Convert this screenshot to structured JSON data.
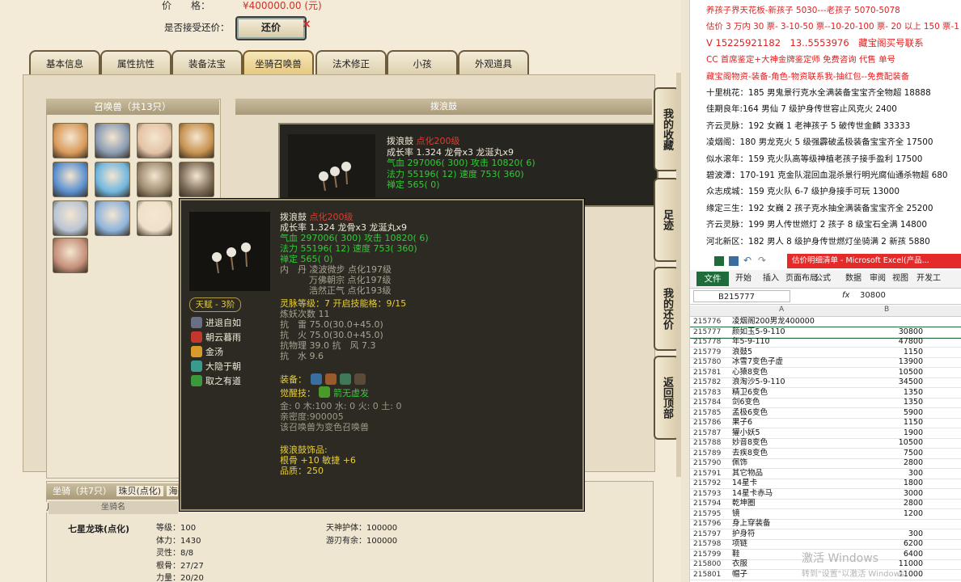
{
  "trade": {
    "price_label": "价　　格：",
    "price_value": "¥400000.00 (元)",
    "accept_label": "是否接受还价：",
    "counter_button": "还价",
    "close_symbol": "×"
  },
  "tabs": [
    "基本信息",
    "属性抗性",
    "装备法宝",
    "坐骑召唤兽",
    "法术修正",
    "小孩",
    "外观道具"
  ],
  "summon_list": {
    "title": "召唤兽（共13只）",
    "pets": [
      {
        "color": "#d99a5a"
      },
      {
        "color": "#8a9cb4"
      },
      {
        "color": "#e4c3a6"
      },
      {
        "color": "#c7924f"
      },
      {
        "color": "#5a8fcf"
      },
      {
        "color": "#6fb6df"
      },
      {
        "color": "#9d8a70"
      },
      {
        "color": "#7b6a55"
      },
      {
        "color": "#b9c4d4"
      },
      {
        "color": "#8eb3dc"
      },
      {
        "color": "#efe0c9"
      },
      {
        "color": "#c58f7a"
      }
    ]
  },
  "detail_header": "拨浪鼓",
  "back_tooltip": {
    "name": "拨浪鼓",
    "tag": "点化200级",
    "l1": "成长率 1.324 龙骨x3 龙涎丸x9",
    "l2": "气血 297006( 300) 攻击 10820( 6)",
    "l3": "法力 55196( 12) 速度 753( 360)",
    "l4": "禅定 565( 0)"
  },
  "tooltip": {
    "name": "拨浪鼓",
    "tag": "点化200级",
    "growth": "成长率 1.324 龙骨x3 龙涎丸x9",
    "hp": "气血 297006( 300) 攻击 10820( 6)",
    "mp": "法力 55196( 12) 速度 753( 360)",
    "zen": "禅定 565( 0)",
    "pill1": "内　丹 凌波微步 点化197级",
    "pill2": "万佛朝宗 点化197级",
    "pill3": "浩然正气 点化193级",
    "spirit": "灵脉等级：7 开启技能格：9/15",
    "refine": "炼妖次数 11",
    "res1": "抗　雷 75.0(30.0+45.0)",
    "res2": "抗　火 75.0(30.0+45.0)",
    "res3": "抗物理 39.0 抗　风 7.3",
    "res4": "抗　水 9.6",
    "talent": "天赋 - 3阶",
    "skills": [
      {
        "label": "进退自如",
        "color": "#6a6f86"
      },
      {
        "label": "朝云暮雨",
        "color": "#c2382d"
      },
      {
        "label": "金汤",
        "color": "#d89a2a"
      },
      {
        "label": "大隐于朝",
        "color": "#3a9a8c"
      },
      {
        "label": "取之有道",
        "color": "#3a9a3a"
      }
    ],
    "equip_label": "装备：",
    "awaken_label": "觉醒技：",
    "awaken_skill": "箭无虚发",
    "elements": "金: 0 木:100 水: 0 火: 0 土: 0",
    "intimacy": "亲密度:900005",
    "variant": "该召唤兽为变色召唤兽",
    "accessory": "拨浪鼓饰品:",
    "acc_stats": "根骨 +10 敏捷 +6",
    "quality": "品质：250"
  },
  "side_buttons": [
    "我的收藏",
    "足迹",
    "我的还价",
    "返回顶部"
  ],
  "mount_section": {
    "title": "坐骑（共7只）",
    "tabs": [
      "珠贝(点化)",
      "海月"
    ],
    "col_header": "坐骑名",
    "name": "七星龙珠(点化)",
    "stats": [
      "等级：100",
      "体力：1430",
      "灵性：8/8",
      "根骨：27/27",
      "力量：20/20"
    ],
    "stats2": [
      "天神护体：100000",
      "游刃有余：100000"
    ]
  },
  "doc": {
    "lines": [
      {
        "t": "养孩子界天花板-新孩子 5030---老孩子 5070-5078",
        "c": "red"
      },
      {
        "t": "估价 3 万内 30 票- 3-10-50 票--10-20-100 票- 20 以上 150 票-1 票",
        "c": "red"
      },
      {
        "t": "V 15225921182　13..5553976　藏宝阁买号联系",
        "c": "redlg"
      },
      {
        "t": "CC 首席鉴定+大神金牌鉴定师 免费咨询 代售 单号",
        "c": "red"
      },
      {
        "t": "藏宝阁物资-装备-角色-物资联系我-抽红包--免费配装备",
        "c": "red"
      },
      {
        "t": "十里桃花：185 男鬼景行克水全满装备宝宝齐全物超 18888",
        "c": "k"
      },
      {
        "t": "佳期良年:164 男仙 7 级护身传世容止风克火 2400",
        "c": "k"
      },
      {
        "t": "齐云灵脉：192 女巍 1 老神孩子 5 破传世金麟 33333",
        "c": "k"
      },
      {
        "t": "凌烟阁：180 男龙克火 5 级强霹破孟极装备宝宝齐全 17500",
        "c": "k"
      },
      {
        "t": "似水滚年：159 克火队高等级神植老孩子接手盈利 17500",
        "c": "k"
      },
      {
        "t": "碧波潭：170-191 克金队混回血混杀景行明光腐仙通杀物超 680",
        "c": "k"
      },
      {
        "t": "众志成城：159 克火队 6-7 级护身接手可玩 13000",
        "c": "k"
      },
      {
        "t": "缘定三生：192 女巍 2 孩子克水抽全满装备宝宝齐全 25200",
        "c": "k"
      },
      {
        "t": "齐云灵脉：199 男人传世燃灯 2 孩子 8 级宝石全满 14800",
        "c": "k"
      },
      {
        "t": "河北新区：182 男人 8 级护身传世燃灯坐骑满 2 新孩 5880",
        "c": "k"
      }
    ]
  },
  "excel": {
    "title": "估价明细清单 - Microsoft Excel(产品...",
    "file_tab": "文件",
    "menus": [
      "开始",
      "插入",
      "页面布局",
      "公式",
      "数据",
      "审阅",
      "视图",
      "开发工"
    ],
    "name_box": "B215777",
    "fx": "fx",
    "formula_value": "30800",
    "col_a": "A",
    "col_b": "B",
    "rows": [
      {
        "n": "215776",
        "a": "凌烟阁200男龙400000",
        "b": ""
      },
      {
        "n": "215777",
        "a": "颜如玉5-9-110",
        "b": "30800"
      },
      {
        "n": "215778",
        "a": "年5-9-110",
        "b": "47800"
      },
      {
        "n": "215779",
        "a": "浪鼓5",
        "b": "1150"
      },
      {
        "n": "215780",
        "a": "冰雪7变色子虚",
        "b": "13900"
      },
      {
        "n": "215781",
        "a": "心猿8变色",
        "b": "10500"
      },
      {
        "n": "215782",
        "a": "浪淘沙5-9-110",
        "b": "34500"
      },
      {
        "n": "215783",
        "a": "精卫6变色",
        "b": "1350"
      },
      {
        "n": "215784",
        "a": "剑6变色",
        "b": "1350"
      },
      {
        "n": "215785",
        "a": "孟极6变色",
        "b": "5900"
      },
      {
        "n": "215786",
        "a": "果子6",
        "b": "1150"
      },
      {
        "n": "215787",
        "a": "獾小妖5",
        "b": "1900"
      },
      {
        "n": "215788",
        "a": "妙音8变色",
        "b": "10500"
      },
      {
        "n": "215789",
        "a": "去疾8变色",
        "b": "7500"
      },
      {
        "n": "215790",
        "a": "佩饰",
        "b": "2800"
      },
      {
        "n": "215791",
        "a": "其它物品",
        "b": "300"
      },
      {
        "n": "215792",
        "a": "14星卡",
        "b": "1800"
      },
      {
        "n": "215793",
        "a": "14星卡赤马",
        "b": "3000"
      },
      {
        "n": "215794",
        "a": "乾坤圈",
        "b": "2800"
      },
      {
        "n": "215795",
        "a": "镜",
        "b": "1200"
      },
      {
        "n": "215796",
        "a": "身上穿装备",
        "b": ""
      },
      {
        "n": "215797",
        "a": "护身符",
        "b": "300"
      },
      {
        "n": "215798",
        "a": "项链",
        "b": "6200"
      },
      {
        "n": "215799",
        "a": "鞋",
        "b": "6400"
      },
      {
        "n": "215800",
        "a": "衣服",
        "b": "11000"
      },
      {
        "n": "215801",
        "a": "帽子",
        "b": "11000"
      }
    ],
    "watermark1": "激活 Windows",
    "watermark2": "转到\"设置\"以激活 Windows。"
  }
}
